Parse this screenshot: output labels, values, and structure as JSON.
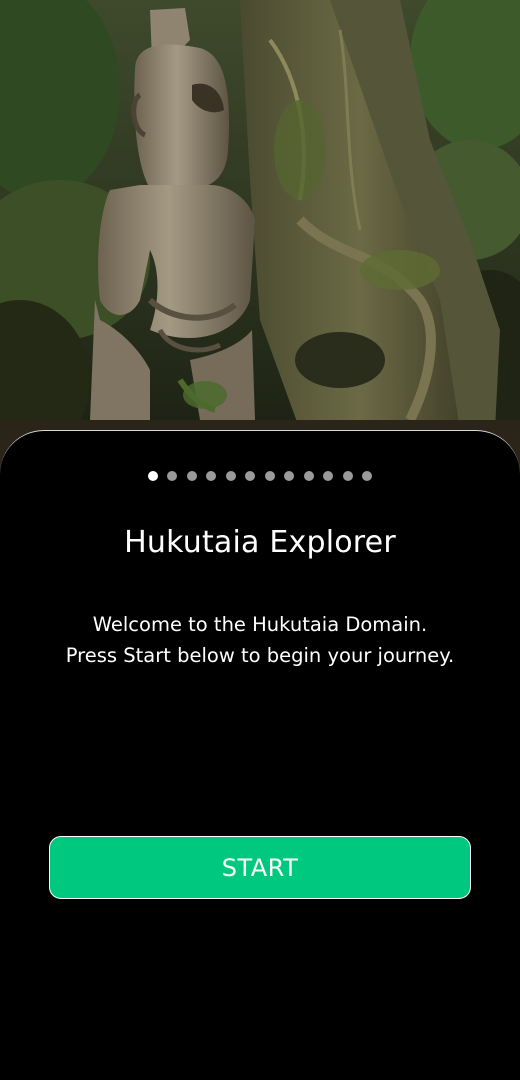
{
  "onboarding": {
    "hero_image": "carved wooden statue in forest",
    "pager": {
      "total": 12,
      "active": 1
    },
    "title": "Hukutaia Explorer",
    "welcome_line1": "Welcome to the Hukutaia Domain.",
    "welcome_line2": "Press Start below to begin your journey.",
    "start_label": "START"
  },
  "colors": {
    "background": "#000000",
    "accent": "#00c97f",
    "dot_active": "#ffffff",
    "dot_inactive": "#9a9a9a"
  }
}
